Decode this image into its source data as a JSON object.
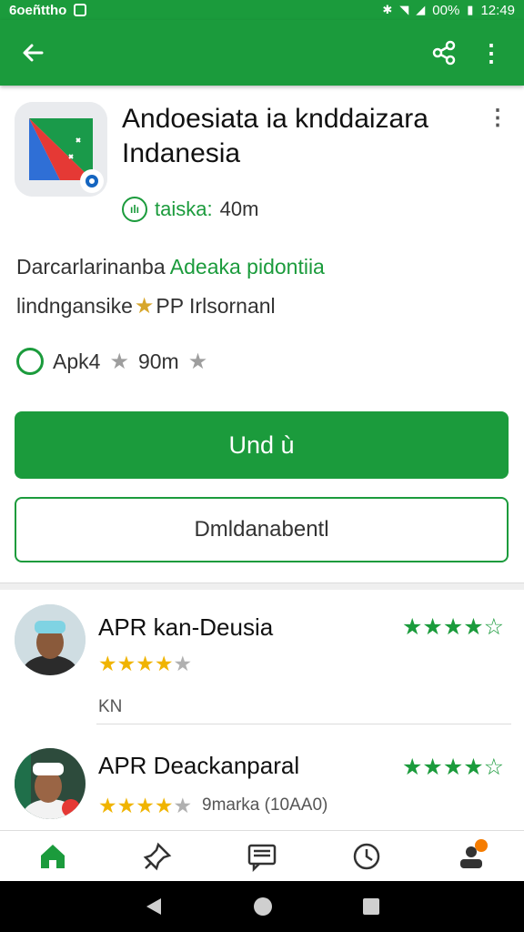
{
  "status_bar": {
    "left_text": "6oeñttho",
    "battery": "00%",
    "time": "12:49"
  },
  "app_bar": {
    "back_icon": "arrow-left-icon",
    "share_icon": "share-icon",
    "more_icon": "more-vert-icon"
  },
  "app": {
    "title": "Andoesiata ia knddaizara Indanesia",
    "meta_label": "taiska:",
    "meta_value": "40m",
    "developer_prefix": "Darcarlarinanba ",
    "developer_link": "Adeaka pidontiia",
    "category_text": "lindngansike",
    "category_suffix": "PP Irlsornanl",
    "stat_text": "Apk4",
    "stat_value": "90m"
  },
  "buttons": {
    "install_label": "Und ù",
    "download_label": "Dmldanabentl"
  },
  "reviews": [
    {
      "name": "APR kan-Deusia",
      "stars_green": "★★★★☆",
      "rating": 4,
      "sub": "KN"
    },
    {
      "name": "APR Deackanparal",
      "stars_green": "★★★★☆",
      "rating": 4,
      "sub": "9marka (10AA0)"
    }
  ],
  "bottom_nav": [
    {
      "icon": "home-icon",
      "active": true
    },
    {
      "icon": "pin-icon",
      "active": false
    },
    {
      "icon": "chat-icon",
      "active": false
    },
    {
      "icon": "clock-icon",
      "active": false
    },
    {
      "icon": "profile-icon",
      "active": false
    }
  ],
  "colors": {
    "brand_green": "#1b9b3c",
    "star_gold": "#f0b400"
  }
}
